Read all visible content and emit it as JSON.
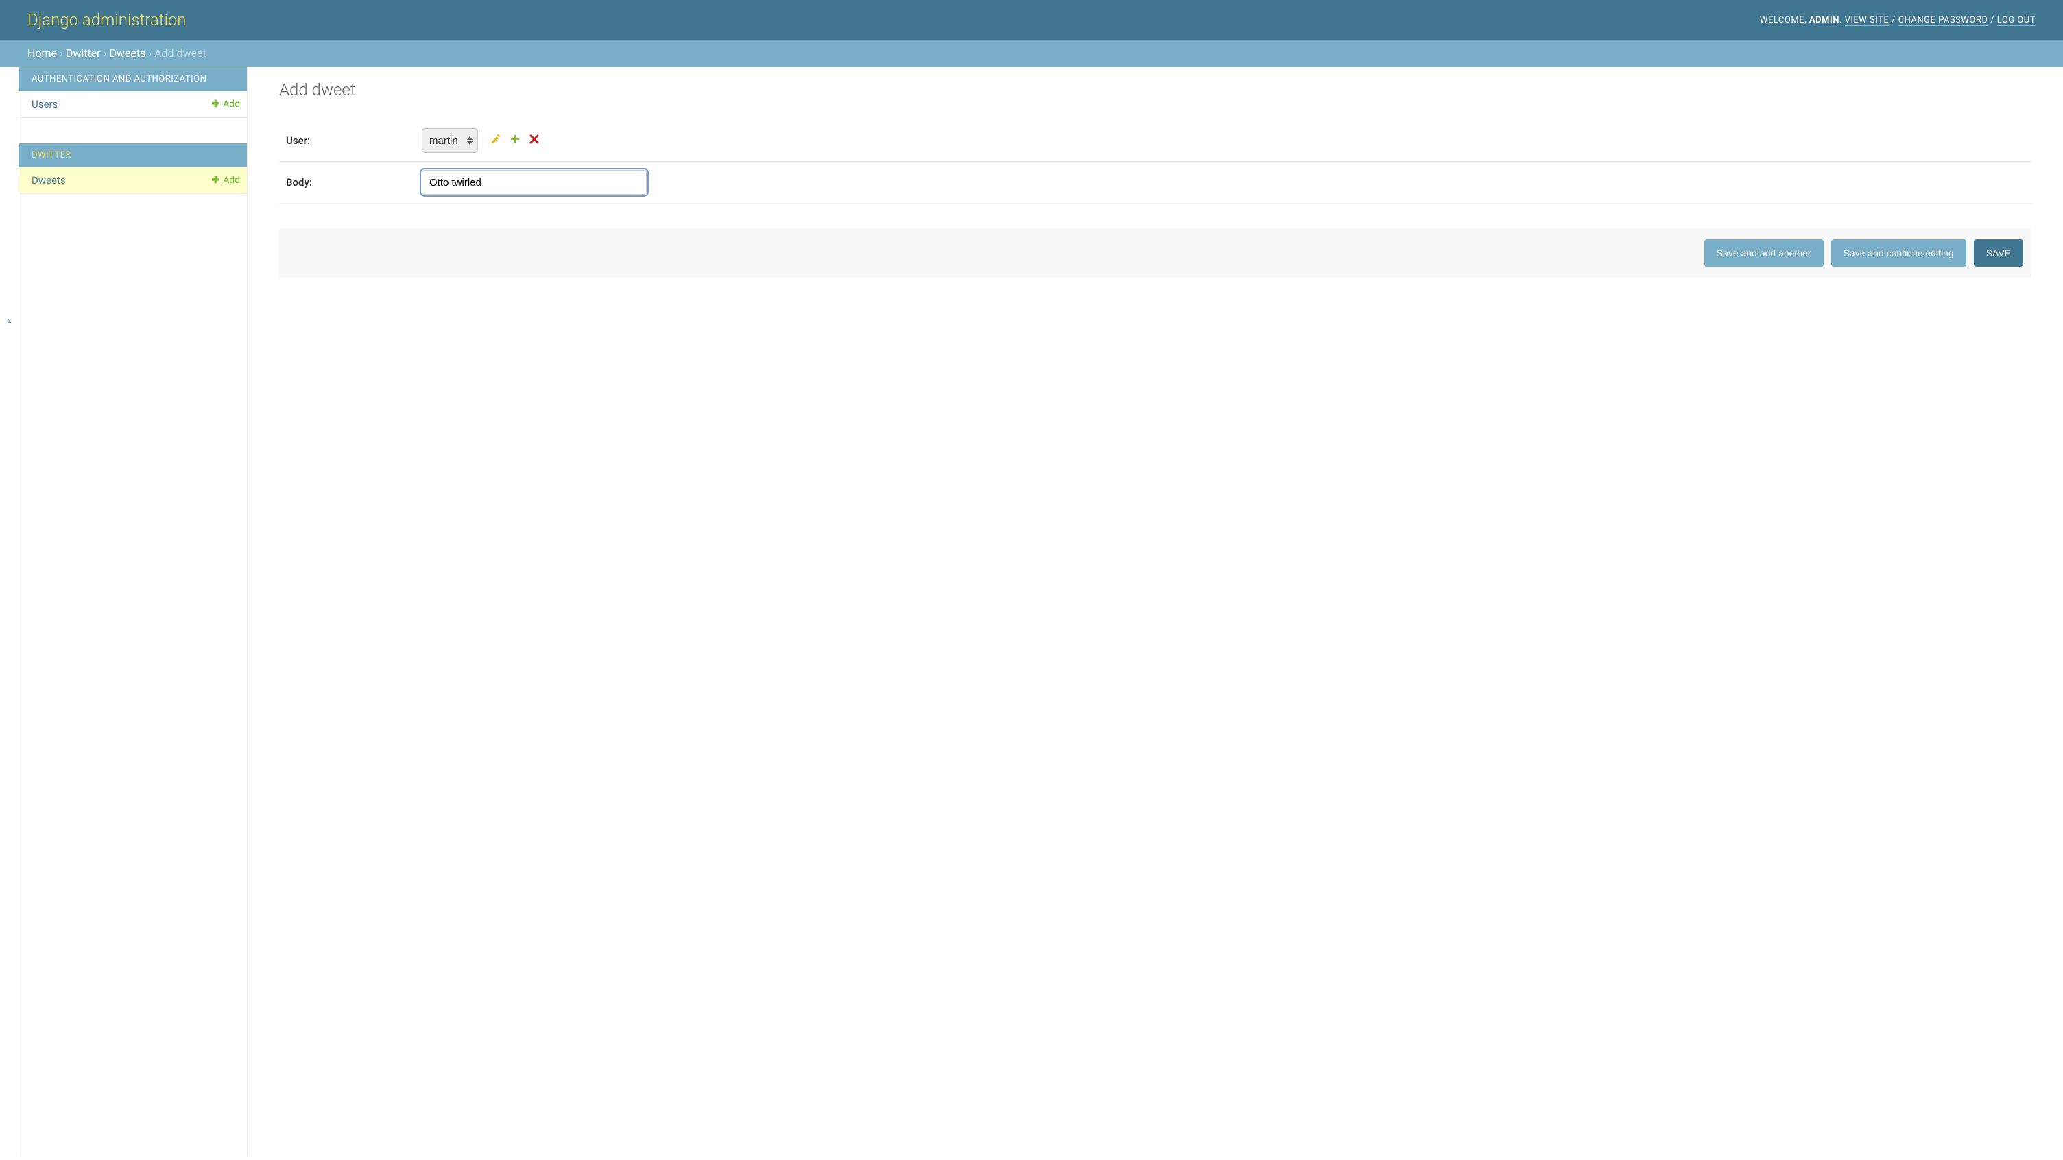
{
  "header": {
    "title": "Django administration",
    "welcome_prefix": "Welcome, ",
    "username": "ADMIN",
    "view_site": "View site",
    "change_password": "Change password",
    "log_out": "Log out"
  },
  "breadcrumbs": {
    "home": "Home",
    "dwitter": "Dwitter",
    "dweets": "Dweets",
    "add_dweet": "Add dweet",
    "separator": " › "
  },
  "sidebar": {
    "toggle_glyph": "«",
    "apps": [
      {
        "label": "Authentication and Authorization",
        "current": false,
        "models": [
          {
            "label": "Users",
            "add_label": "Add",
            "current": false
          }
        ]
      },
      {
        "label": "Dwitter",
        "current": true,
        "models": [
          {
            "label": "Dweets",
            "add_label": "Add",
            "current": true
          }
        ]
      }
    ]
  },
  "content": {
    "title": "Add dweet",
    "fields": {
      "user": {
        "label": "User:",
        "selected": "martin",
        "icons": {
          "change": "pencil-icon",
          "add": "plus-icon",
          "delete": "x-icon"
        }
      },
      "body": {
        "label": "Body:",
        "value": "Otto twirled"
      }
    },
    "actions": {
      "save_add_another": "Save and add another",
      "save_continue": "Save and continue editing",
      "save": "SAVE"
    }
  }
}
